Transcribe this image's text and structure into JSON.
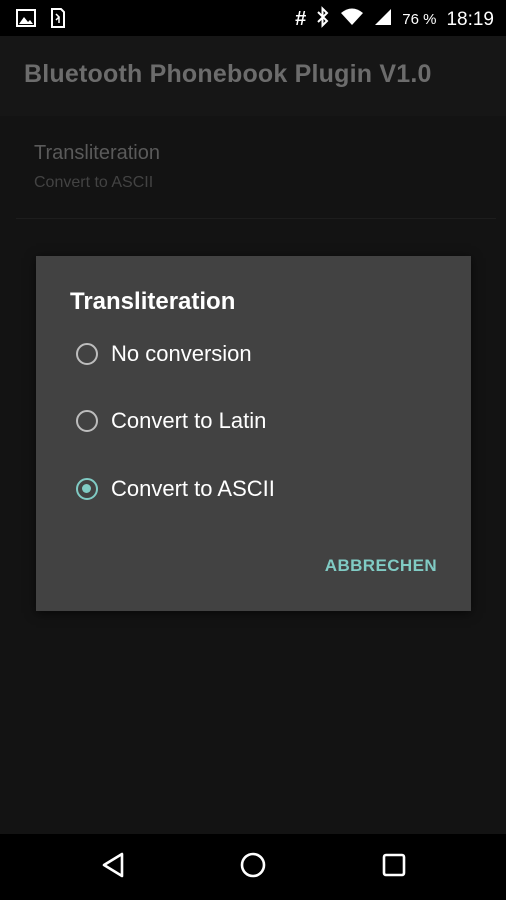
{
  "status_bar": {
    "left_icons": [
      "image-icon",
      "sim-card-icon"
    ],
    "hash": "#",
    "battery_percent": "76 %",
    "time": "18:19"
  },
  "app_bar": {
    "title": "Bluetooth Phonebook Plugin V1.0"
  },
  "preference": {
    "title": "Transliteration",
    "summary": "Convert to ASCII"
  },
  "dialog": {
    "title": "Transliteration",
    "options": [
      {
        "label": "No conversion",
        "checked": false
      },
      {
        "label": "Convert to Latin",
        "checked": false
      },
      {
        "label": "Convert to ASCII",
        "checked": true
      }
    ],
    "cancel_label": "ABBRECHEN"
  },
  "nav_bar": {
    "buttons": [
      "back-icon",
      "home-icon",
      "recents-icon"
    ]
  },
  "colors": {
    "accent": "#80cbc4",
    "dialog_bg": "#424242",
    "background": "#131313",
    "status_bar_bg": "#000000"
  }
}
